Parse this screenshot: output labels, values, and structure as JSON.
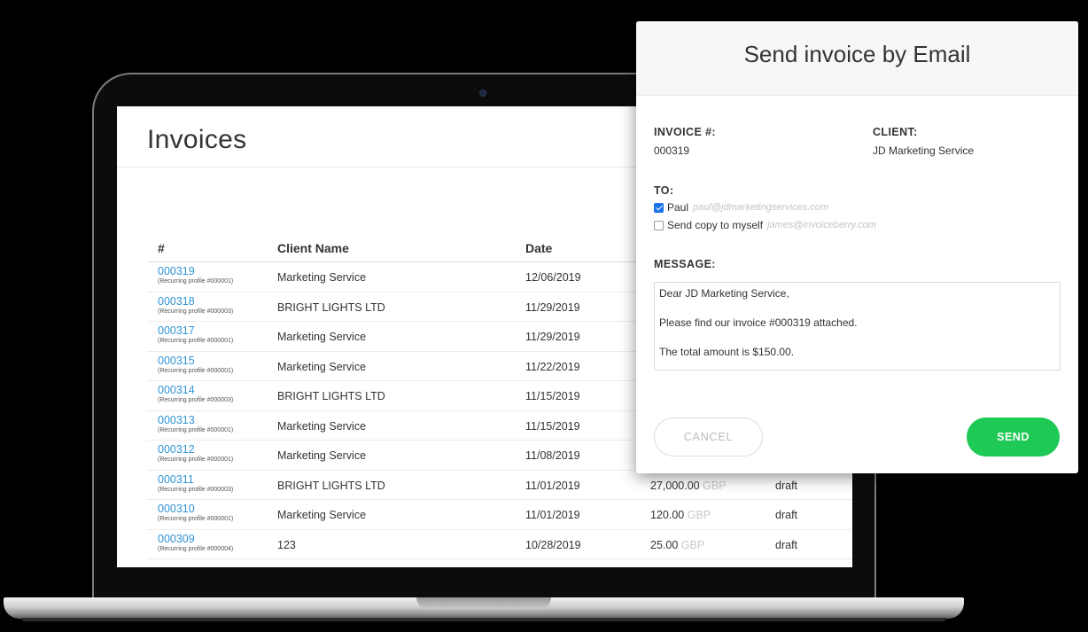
{
  "invoices_page": {
    "title": "Invoices",
    "columns": [
      "#",
      "Client Name",
      "Date"
    ],
    "rows": [
      {
        "number": "000319",
        "profile": "(Recurring profile #000001)",
        "client": "Marketing Service",
        "date": "12/06/2019",
        "amount": "",
        "currency": "",
        "status": ""
      },
      {
        "number": "000318",
        "profile": "(Recurring profile #000003)",
        "client": "BRIGHT LIGHTS LTD",
        "date": "11/29/2019",
        "amount": "",
        "currency": "",
        "status": ""
      },
      {
        "number": "000317",
        "profile": "(Recurring profile #000001)",
        "client": "Marketing Service",
        "date": "11/29/2019",
        "amount": "",
        "currency": "",
        "status": ""
      },
      {
        "number": "000315",
        "profile": "(Recurring profile #000001)",
        "client": "Marketing Service",
        "date": "11/22/2019",
        "amount": "",
        "currency": "",
        "status": ""
      },
      {
        "number": "000314",
        "profile": "(Recurring profile #000003)",
        "client": "BRIGHT LIGHTS LTD",
        "date": "11/15/2019",
        "amount": "",
        "currency": "",
        "status": ""
      },
      {
        "number": "000313",
        "profile": "(Recurring profile #000001)",
        "client": "Marketing Service",
        "date": "11/15/2019",
        "amount": "",
        "currency": "",
        "status": ""
      },
      {
        "number": "000312",
        "profile": "(Recurring profile #000001)",
        "client": "Marketing Service",
        "date": "11/08/2019",
        "amount": "",
        "currency": "",
        "status": ""
      },
      {
        "number": "000311",
        "profile": "(Recurring profile #000003)",
        "client": "BRIGHT LIGHTS LTD",
        "date": "11/01/2019",
        "amount": "27,000.00",
        "currency": "GBP",
        "status": "draft"
      },
      {
        "number": "000310",
        "profile": "(Recurring profile #000001)",
        "client": "Marketing Service",
        "date": "11/01/2019",
        "amount": "120.00",
        "currency": "GBP",
        "status": "draft"
      },
      {
        "number": "000309",
        "profile": "(Recurring profile #000004)",
        "client": "123",
        "date": "10/28/2019",
        "amount": "25.00",
        "currency": "GBP",
        "status": "draft"
      }
    ]
  },
  "modal": {
    "title": "Send invoice by Email",
    "invoice_label": "INVOICE #:",
    "invoice_value": "000319",
    "client_label": "CLIENT:",
    "client_value": "JD Marketing Service",
    "to_label": "TO:",
    "recipients": [
      {
        "name": "Paul",
        "email": "paul@jdmarketingservices.com",
        "checked": true
      },
      {
        "name": "Send copy to myself",
        "email": "james@invoiceberry.com",
        "checked": false
      }
    ],
    "message_label": "MESSAGE:",
    "message_lines": [
      "Dear JD Marketing Service,",
      "Please find our invoice #000319 attached.",
      "The total amount is $150.00."
    ],
    "cancel_label": "CANCEL",
    "send_label": "SEND"
  },
  "colors": {
    "link": "#2f93d6",
    "send": "#1ec955",
    "checkbox": "#1a73e8"
  }
}
